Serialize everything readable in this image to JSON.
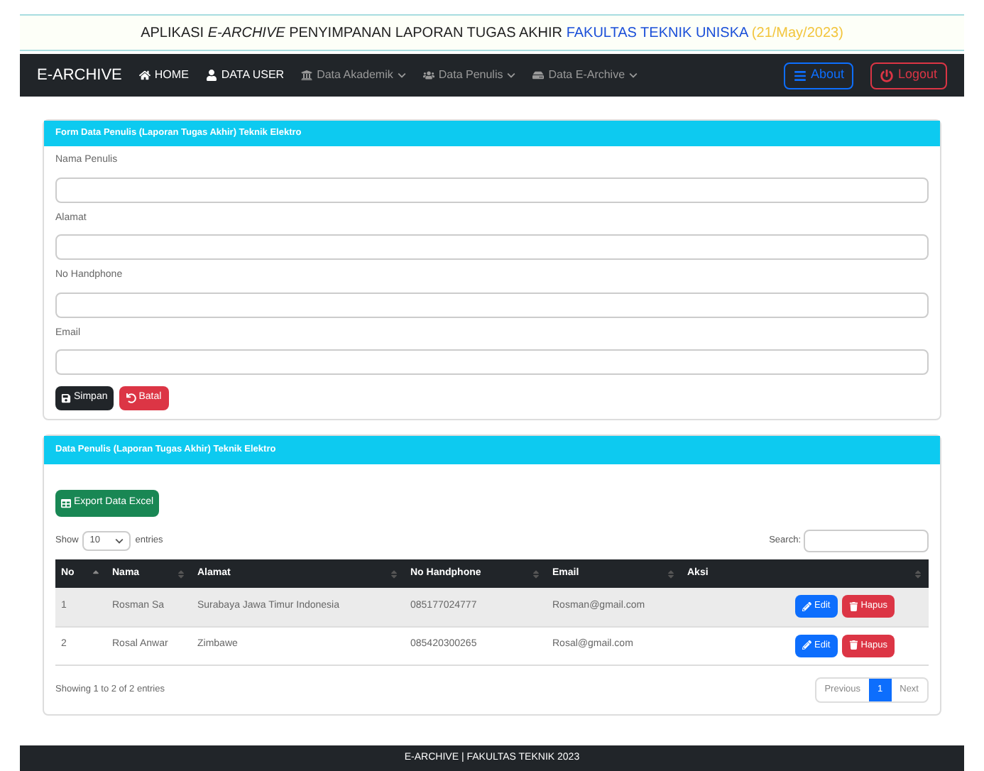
{
  "banner": {
    "prefix": "APLIKASI ",
    "italic": "E-ARCHIVE",
    "middle": " PENYIMPANAN LAPORAN TUGAS AKHIR ",
    "faculty": "FAKULTAS TEKNIK UNISKA",
    "date": "(21/May/2023)"
  },
  "navbar": {
    "brand": "E-ARCHIVE",
    "items": [
      {
        "label": "HOME",
        "dropdown": false
      },
      {
        "label": "DATA USER",
        "dropdown": false
      },
      {
        "label": "Data Akademik",
        "dropdown": true
      },
      {
        "label": "Data Penulis",
        "dropdown": true
      },
      {
        "label": "Data E-Archive",
        "dropdown": true
      }
    ],
    "about": "About",
    "logout": "Logout"
  },
  "form": {
    "title": "Form Data Penulis (Laporan Tugas Akhir) Teknik Elektro",
    "fields": [
      {
        "label": "Nama Penulis"
      },
      {
        "label": "Alamat"
      },
      {
        "label": "No Handphone"
      },
      {
        "label": "Email"
      }
    ],
    "save": "Simpan",
    "reset": "Batal"
  },
  "table_card": {
    "title": "Data Penulis (Laporan Tugas Akhir) Teknik Elektro",
    "export": "Export Data Excel",
    "show_label": "Show",
    "show_value": "10",
    "entries_label": "entries",
    "search_label": "Search:",
    "columns": [
      "No",
      "Nama",
      "Alamat",
      "No Handphone",
      "Email",
      "Aksi"
    ],
    "rows": [
      {
        "cells": [
          "1",
          "Rosman Sa",
          "Surabaya Jawa Timur Indonesia",
          "085177024777",
          "Rosman@gmail.com"
        ],
        "edit": "Edit",
        "delete": "Hapus"
      },
      {
        "cells": [
          "2",
          "Rosal Anwar",
          "Zimbawe",
          "085420300265",
          "Rosal@gmail.com"
        ],
        "edit": "Edit",
        "delete": "Hapus"
      }
    ],
    "info": "Showing 1 to 2 of 2 entries",
    "pages": [
      {
        "label": "Previous",
        "selected": false
      },
      {
        "label": "1",
        "selected": true
      },
      {
        "label": "Next",
        "selected": false
      }
    ]
  },
  "footer": "E-ARCHIVE | FAKULTAS TEKNIK 2023"
}
